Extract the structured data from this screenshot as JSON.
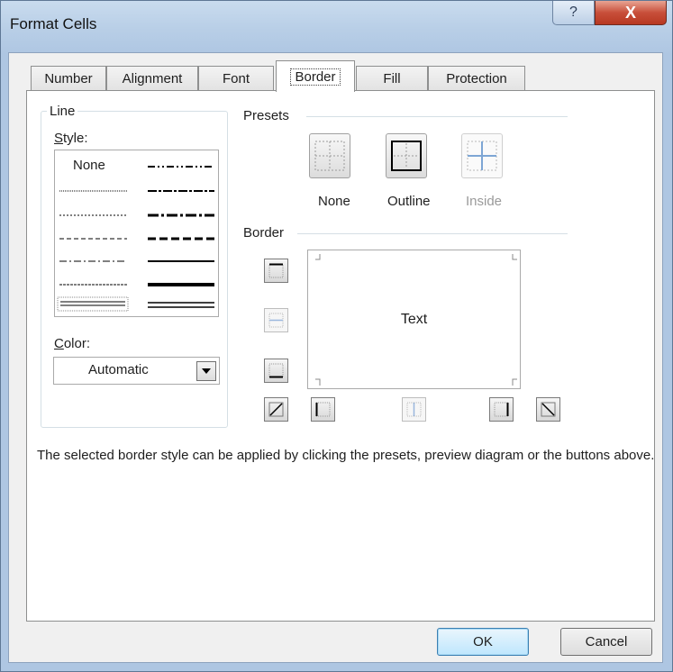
{
  "window": {
    "title": "Format Cells",
    "help_glyph": "?",
    "close_glyph": "X"
  },
  "tabs": [
    {
      "label": "Number"
    },
    {
      "label": "Alignment"
    },
    {
      "label": "Font"
    },
    {
      "label": "Border",
      "active": true
    },
    {
      "label": "Fill"
    },
    {
      "label": "Protection"
    }
  ],
  "line_group": {
    "title": "Line",
    "style_label": "Style:",
    "none_option": "None",
    "color_label": "Color:",
    "color_value": "Automatic"
  },
  "presets": {
    "title": "Presets",
    "items": [
      {
        "label": "None",
        "enabled": true
      },
      {
        "label": "Outline",
        "enabled": true
      },
      {
        "label": "Inside",
        "enabled": false
      }
    ]
  },
  "border_section": {
    "title": "Border",
    "preview_text": "Text"
  },
  "description": "The selected border style can be applied by clicking the presets, preview diagram or the buttons above.",
  "buttons": {
    "ok": "OK",
    "cancel": "Cancel"
  },
  "colors": {
    "accent_blue": "#3c7fb1",
    "close_red": "#c84f3a",
    "frame": "#aec6e2"
  }
}
